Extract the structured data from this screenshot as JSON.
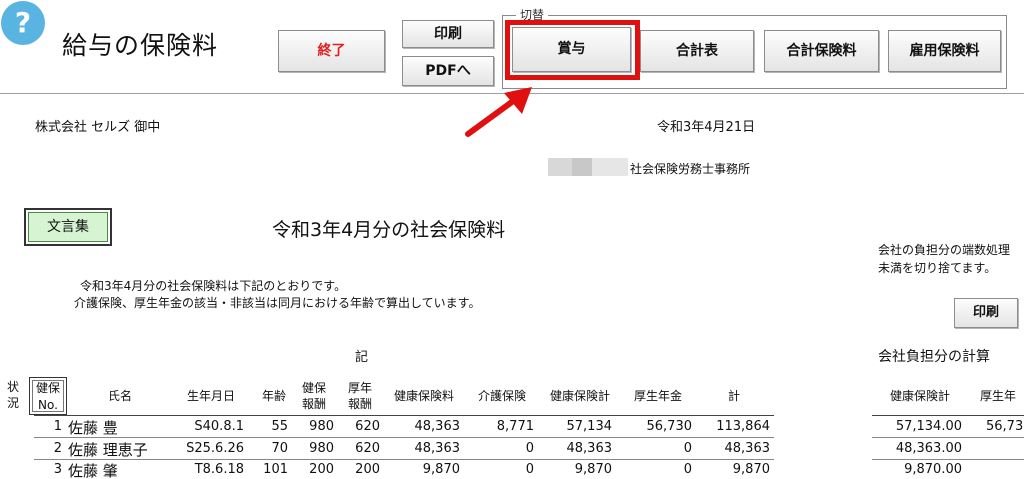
{
  "header": {
    "help_glyph": "?",
    "title": "給与の保険料",
    "end_label": "終了",
    "print_label": "印刷",
    "pdf_label": "PDFへ",
    "switch_group_label": "切替",
    "bonus_label": "賞与",
    "total_label": "合計表",
    "total_insurance_label": "合計保険料",
    "employment_insurance_label": "雇用保険料"
  },
  "doc": {
    "client": "株式会社 セルズ 御中",
    "date": "令和3年4月21日",
    "office": "社会保険労務士事務所",
    "phrases_button": "文言集",
    "title": "令和3年4月分の社会保険料",
    "intro_line1": "令和3年4月分の社会保険料は下記のとおりです。",
    "intro_line2": "介護保険、厚生年金の該当・非該当は同月における年齢で算出しています。",
    "side_note_line1": "会社の負担分の端数処理",
    "side_note_line2": "未満を切り捨てます。",
    "side_print_label": "印刷",
    "ki_label": "記",
    "side_calc_title": "会社負担分の計算"
  },
  "table": {
    "status_header": "状況",
    "kenpo_no_header_line1": "健保",
    "kenpo_no_header_line2": "No.",
    "headers": {
      "name": "氏名",
      "birth": "生年月日",
      "age": "年齢",
      "kenpo_std_1": "健保",
      "kenpo_std_2": "報酬",
      "kosei_std_1": "厚年",
      "kosei_std_2": "報酬",
      "health": "健康保険料",
      "care": "介護保険",
      "health_total": "健康保険計",
      "pension": "厚生年金",
      "total": "計"
    },
    "rows": [
      {
        "no": "1",
        "name": "佐藤 豊",
        "birth": "S40.8.1",
        "age": "55",
        "kenpo": "980",
        "kosei": "620",
        "health": "48,363",
        "care": "8,771",
        "health_total": "57,134",
        "pension": "56,730",
        "total": "113,864"
      },
      {
        "no": "2",
        "name": "佐藤 理恵子",
        "birth": "S25.6.26",
        "age": "70",
        "kenpo": "980",
        "kosei": "620",
        "health": "48,363",
        "care": "0",
        "health_total": "48,363",
        "pension": "0",
        "total": "48,363"
      },
      {
        "no": "3",
        "name": "佐藤 肇",
        "birth": "T8.6.18",
        "age": "101",
        "kenpo": "200",
        "kosei": "200",
        "health": "9,870",
        "care": "0",
        "health_total": "9,870",
        "pension": "0",
        "total": "9,870"
      }
    ]
  },
  "side_table": {
    "headers": {
      "health_total": "健康保険計",
      "pension": "厚生年"
    },
    "rows": [
      {
        "health_total": "57,134.00",
        "pension": "56,73"
      },
      {
        "health_total": "48,363.00",
        "pension": ""
      },
      {
        "health_total": "9,870.00",
        "pension": ""
      }
    ]
  },
  "colors": {
    "highlight": "#e01010",
    "end_text": "#e02020",
    "help_bg": "#5ab4e2",
    "phrases_bg": "#d6f3d2"
  }
}
